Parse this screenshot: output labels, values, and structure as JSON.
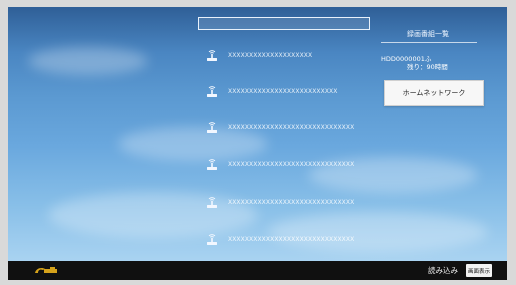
{
  "main": {
    "search_placeholder": "",
    "devices": [
      {
        "label": "XXXXXXXXXXXXXXXXXXXX",
        "icon": "network-device-icon"
      },
      {
        "label": "XXXXXXXXXXXXXXXXXXXXXXXXXX",
        "icon": "network-device-icon"
      },
      {
        "label": "XXXXXXXXXXXXXXXXXXXXXXXXXXXXXX",
        "icon": "network-device-icon"
      },
      {
        "label": "XXXXXXXXXXXXXXXXXXXXXXXXXXXXXX",
        "icon": "network-device-icon"
      },
      {
        "label": "XXXXXXXXXXXXXXXXXXXXXXXXXXXXXX",
        "icon": "network-device-icon"
      },
      {
        "label": "XXXXXXXXXXXXXXXXXXXXXXXXXXXXXX",
        "icon": "network-device-icon"
      }
    ]
  },
  "info_panel": {
    "title": "録画番組一覧",
    "disk_name": "HDD0000001ふ",
    "remaining": "残り：90時間",
    "home_network_button": "ホームネットワーク"
  },
  "bottom_bar": {
    "logo": "brand-logo-icon",
    "load_label": "読み込み",
    "screen_display_button": "画面表示"
  },
  "colors": {
    "background_top": "#2f5f97",
    "background_bottom": "#a9d3f1",
    "bottom_bar": "#101010",
    "button": "#f7f7f7",
    "logo": "#d5a21b"
  }
}
